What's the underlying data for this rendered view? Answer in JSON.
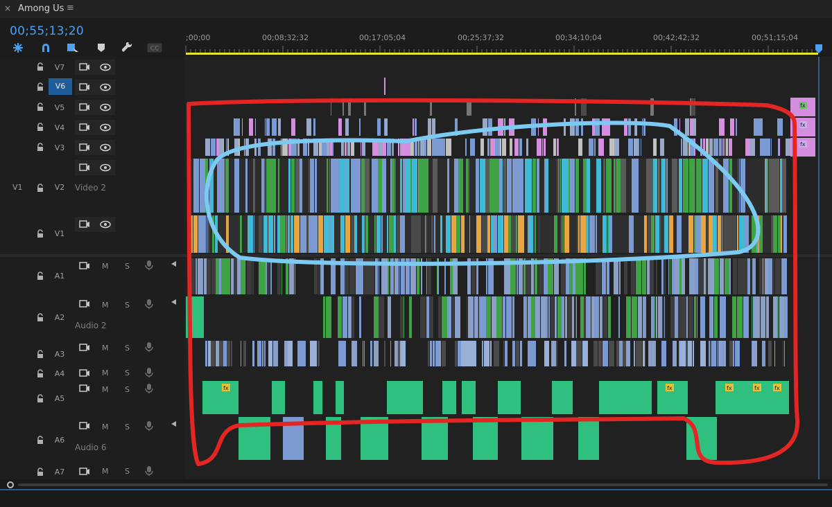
{
  "window": {
    "close_glyph": "×",
    "title": "Among Us",
    "menu_glyph": "≡"
  },
  "timecode": "00;55;13;20",
  "tools": [
    "snap-insert-icon",
    "magnet-snap-icon",
    "linked-selection-icon",
    "add-marker-icon",
    "wrench-settings-icon",
    "captions-icon"
  ],
  "captions_label": "CC",
  "ruler_ticks": [
    ";00;00",
    "00;08;32;32",
    "00;17;05;04",
    "00;25;37;32",
    "00;34;10;04",
    "00;42;42;32",
    "00;51;15;04"
  ],
  "video_tracks": [
    {
      "id": "V7",
      "label": "",
      "source": ""
    },
    {
      "id": "V6",
      "label": "",
      "source": "",
      "active": true
    },
    {
      "id": "V5",
      "label": "",
      "source": ""
    },
    {
      "id": "V4",
      "label": "",
      "source": ""
    },
    {
      "id": "V3",
      "label": "",
      "source": ""
    },
    {
      "id": "V2",
      "label": "Video 2",
      "source": "V1"
    },
    {
      "id": "V1",
      "label": "",
      "source": ""
    }
  ],
  "audio_tracks": [
    {
      "id": "A1",
      "label": ""
    },
    {
      "id": "A2",
      "label": "Audio 2"
    },
    {
      "id": "A3",
      "label": ""
    },
    {
      "id": "A4",
      "label": ""
    },
    {
      "id": "A5",
      "label": ""
    },
    {
      "id": "A6",
      "label": "Audio 6"
    },
    {
      "id": "A7",
      "label": ""
    }
  ],
  "mute_label": "M",
  "solo_label": "S",
  "fx_badge": "fx",
  "colors": {
    "timecode": "#4aa0f2",
    "active_track": "#1f5d9a",
    "clip_green": "#3fa346",
    "clip_blue": "#7b9ad1",
    "clip_pink": "#d58de0",
    "clip_orange": "#e7a63f",
    "clip_cyan": "#3fbbd6",
    "audio_clip": "#2fbf7f",
    "annotation_red": "#e32624",
    "annotation_blue": "#7cc9f2",
    "work_area": "#e6e62a"
  }
}
